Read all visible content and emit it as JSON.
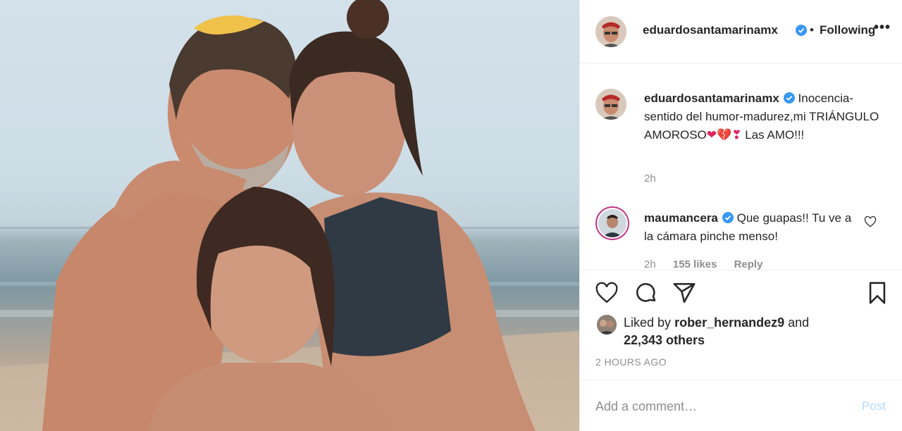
{
  "post": {
    "image_alt": "Family photo on the beach",
    "author": {
      "username": "eduardosantamarinamx",
      "verified": true,
      "follow_separator": "•",
      "follow_status": "Following",
      "more_icon": "more-dots-icon"
    },
    "caption": {
      "username": "eduardosantamarinamx",
      "text": "Inocencia-sentido del humor-madurez,mi TRIÁNGULO AMOROSO",
      "emoji": "❤💔❣",
      "text_end": "Las AMO!!!",
      "time": "2h"
    },
    "comments": [
      {
        "username": "maumancera",
        "verified": true,
        "text": "Que guapas!! Tu ve a la cámara pinche menso!",
        "time": "2h",
        "likes": "155 likes",
        "reply": "Reply"
      }
    ],
    "actions": {
      "like_icon": "heart-icon",
      "comment_icon": "comment-icon",
      "share_icon": "share-icon",
      "save_icon": "bookmark-icon"
    },
    "likes": {
      "prefix": "Liked by",
      "user": "rober_hernandez9",
      "joiner": "and",
      "others": "22,343 others"
    },
    "timestamp": "2 HOURS AGO",
    "add_comment": {
      "placeholder": "Add a comment…",
      "post_label": "Post"
    }
  },
  "colors": {
    "verified": "#3897f0",
    "post_disabled": "#b3dbff",
    "meta": "#8e8e8e",
    "text": "#262626",
    "story_ring": "#c13584"
  }
}
